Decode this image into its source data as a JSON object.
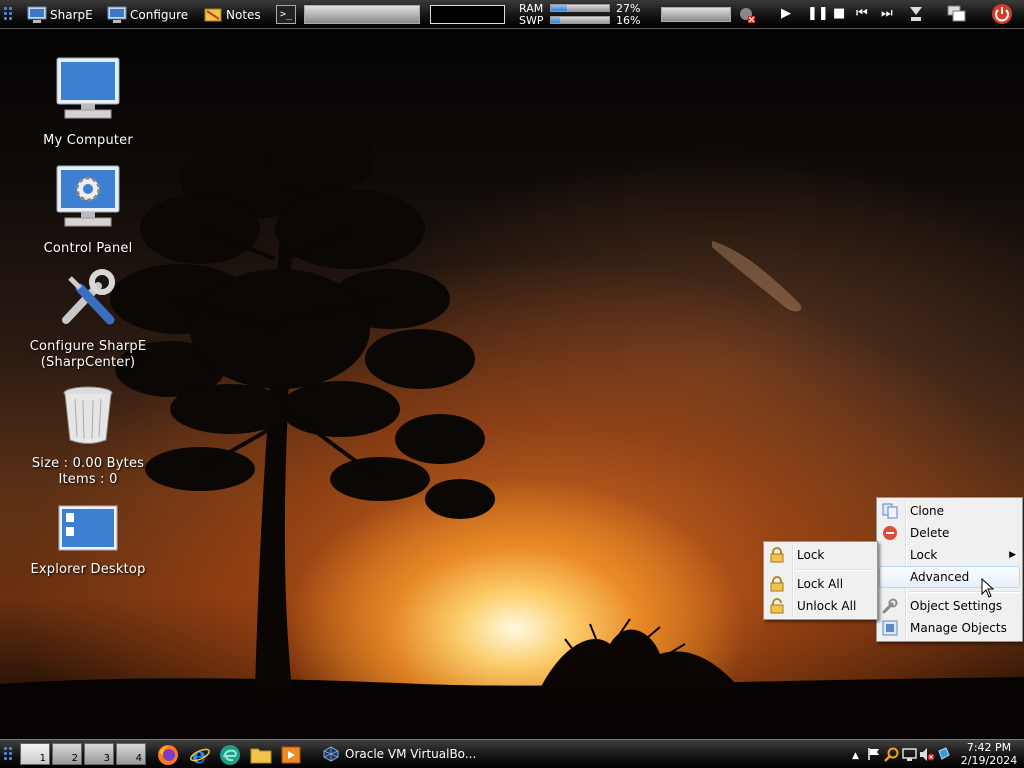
{
  "top_panel": {
    "sharpe_label": "SharpE",
    "configure_label": "Configure",
    "notes_label": "Notes",
    "terminal_icon_text": ">_",
    "ram_label": "RAM",
    "swp_label": "SWP",
    "ram_percent": "27%",
    "swp_percent": "16%",
    "ram_fraction": 0.27,
    "swp_fraction": 0.16
  },
  "desktop_icons": [
    {
      "label": "My Computer",
      "icon": "computer-icon"
    },
    {
      "label": "Control Panel",
      "icon": "control-panel-icon"
    },
    {
      "label": "Configure SharpE",
      "label2": "(SharpCenter)",
      "icon": "tools-icon"
    },
    {
      "label": "Size : 0.00 Bytes",
      "label2": "Items : 0",
      "icon": "trash-icon"
    },
    {
      "label": "Explorer Desktop",
      "icon": "explorer-desktop-icon"
    }
  ],
  "context_menu": {
    "clone": "Clone",
    "delete": "Delete",
    "lock": "Lock",
    "advanced": "Advanced",
    "object_settings": "Object Settings",
    "manage_objects": "Manage Objects"
  },
  "lock_submenu": {
    "lock": "Lock",
    "lock_all": "Lock All",
    "unlock_all": "Unlock All"
  },
  "taskbar": {
    "workspaces": [
      "1",
      "2",
      "3",
      "4"
    ],
    "active_workspace": "1",
    "task_label": "Oracle VM VirtualBo...",
    "clock_time": "7:42 PM",
    "clock_date": "2/19/2024",
    "quick_launch": [
      "firefox-icon",
      "ie-icon",
      "edge-icon",
      "folder-icon",
      "media-player-icon"
    ]
  },
  "colors": {
    "accent_blue": "#3a7fd0",
    "power_red": "#d83a2a",
    "menu_bg": "#f0f0f0"
  }
}
